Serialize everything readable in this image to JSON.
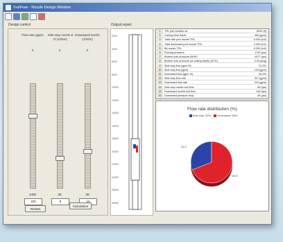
{
  "window": {
    "title": "SubFlow - Nozzle Design Window"
  },
  "toolbar": {
    "buttons": [
      "open-icon",
      "save-icon",
      "play-icon",
      "settings-icon",
      "help-icon"
    ]
  },
  "design_control": {
    "label": "Design control",
    "columns": [
      {
        "label": "Flow rate (gpm)",
        "max": "0",
        "min": "1400",
        "value": "400",
        "level": 0.3
      },
      {
        "label": "Side way nozzle & D (1/32in)",
        "max": "0",
        "min": "28",
        "value": "8",
        "level": 0.72
      },
      {
        "label": "Downward nozzle (1/32in)",
        "max": "0",
        "min": "28",
        "value": "10",
        "level": 0.65
      }
    ],
    "reset_label": "Restart",
    "calculate_label": "Calculation"
  },
  "output_report": {
    "label": "Output report",
    "depth_ticks": [
      "2000",
      "4000",
      "6000",
      "8000",
      "10000",
      "12000",
      "14000",
      "16000",
      "18000",
      "20000",
      "22000",
      "24000",
      "26000",
      "28000"
    ]
  },
  "table": {
    "rows": [
      {
        "num": "1",
        "name": "TRL (bit) location at",
        "val": "8000 (ft)"
      },
      {
        "num": "2",
        "name": "Casing shoe depth",
        "val": "460 (gpm)"
      },
      {
        "num": "3",
        "name": "Total side port nozzle TFA",
        "val": "0.000 (in2)"
      },
      {
        "num": "4",
        "name": "Total downward port nozzle TFA",
        "val": "0.000 (in2)"
      },
      {
        "num": "5",
        "name": "Bit nozzle TFA",
        "val": "0.000 (in2)"
      },
      {
        "num": "6",
        "name": "Flowing pressure",
        "val": "1750 (psi)"
      },
      {
        "num": "7",
        "name": "Bottom hole pressure (BHP)",
        "val": "4977 (psi)"
      },
      {
        "num": "8",
        "name": "Bottom hole pressure (at casing depth) (ECD)",
        "val": "0.00 (ppg)"
      },
      {
        "num": "9",
        "name": "Side way flow (gpm %)",
        "val": "31.0%"
      },
      {
        "num": "10",
        "name": "Side way flow (gpm)",
        "val": "143 (gpm)"
      },
      {
        "num": "11",
        "name": "Downward flow (gpm %)",
        "val": "69.0%"
      },
      {
        "num": "12",
        "name": "Side way flow rate",
        "val": "317 (gpm)"
      },
      {
        "num": "13",
        "name": "Downward flow rate",
        "val": "215 (gpm)"
      },
      {
        "num": "14",
        "name": "Side way nozzle exit flow",
        "val": "89 (fps)"
      },
      {
        "num": "15",
        "name": "Downward nozzle exit flow",
        "val": "145 (fps)"
      },
      {
        "num": "16",
        "name": "Downward pressure drop",
        "val": "80 (psi)"
      }
    ]
  },
  "chart_data": {
    "type": "pie",
    "title": "Flow rate distribution (%)",
    "categories": [
      "Side way: 31%",
      "Downward: 69%"
    ],
    "values": [
      31,
      69
    ],
    "colors": [
      "#2a45a8",
      "#e0232b"
    ],
    "slice_labels": [
      "31.0",
      "69.0"
    ],
    "legend_position": "top"
  }
}
